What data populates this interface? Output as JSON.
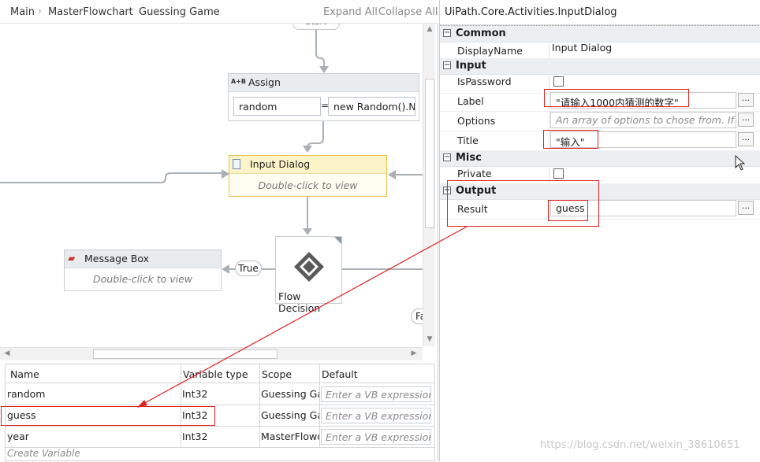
{
  "breadcrumb": [
    "Main",
    "MasterFlowchart",
    "Guessing Game"
  ],
  "toolbar": {
    "expand_all": "Expand All",
    "collapse_all": "Collapse All"
  },
  "canvas": {
    "start_label": "Start",
    "assign": {
      "title": "Assign",
      "icon_text": "A+B",
      "to_value": "random",
      "equals": "=",
      "value_expr": "new Random().N"
    },
    "input_dialog": {
      "title": "Input Dialog",
      "hint": "Double-click to view"
    },
    "message_box": {
      "title": "Message Box",
      "hint": "Double-click to view"
    },
    "flow_decision": {
      "label": "Flow Decision",
      "true_label": "True",
      "false_label": "Fa"
    }
  },
  "variables": {
    "headers": [
      "Name",
      "Variable type",
      "Scope",
      "Default"
    ],
    "rows": [
      {
        "name": "random",
        "type": "Int32",
        "scope": "Guessing Ga",
        "default": "Enter a VB expression"
      },
      {
        "name": "guess",
        "type": "Int32",
        "scope": "Guessing Ga",
        "default": "Enter a VB expression"
      },
      {
        "name": "year",
        "type": "Int32",
        "scope": "MasterFlowc",
        "default": "Enter a VB expression"
      }
    ],
    "create_label": "Create Variable"
  },
  "properties": {
    "title": "UiPath.Core.Activities.InputDialog",
    "categories": {
      "common": "Common",
      "input": "Input",
      "misc": "Misc",
      "output": "Output"
    },
    "toggles": {
      "expanded": "−",
      "collapsed": "+"
    },
    "rows": {
      "display_name": {
        "name": "DisplayName",
        "value": "Input Dialog"
      },
      "is_password": {
        "name": "IsPassword",
        "checked": false
      },
      "label": {
        "name": "Label",
        "value": "\"请输入1000内猜测的数字\""
      },
      "options": {
        "name": "Options",
        "placeholder": "An array of options to chose from. If se"
      },
      "title": {
        "name": "Title",
        "value": "\"输入\""
      },
      "private": {
        "name": "Private",
        "checked": false
      },
      "result": {
        "name": "Result",
        "value": "guess"
      }
    },
    "dots_label": "..."
  },
  "watermark": "https://blog.csdn.net/weixin_38610651",
  "colors": {
    "annotation": "#e02020",
    "selected_activity": "#fdf3c8",
    "selected_border": "#e8c34a"
  }
}
